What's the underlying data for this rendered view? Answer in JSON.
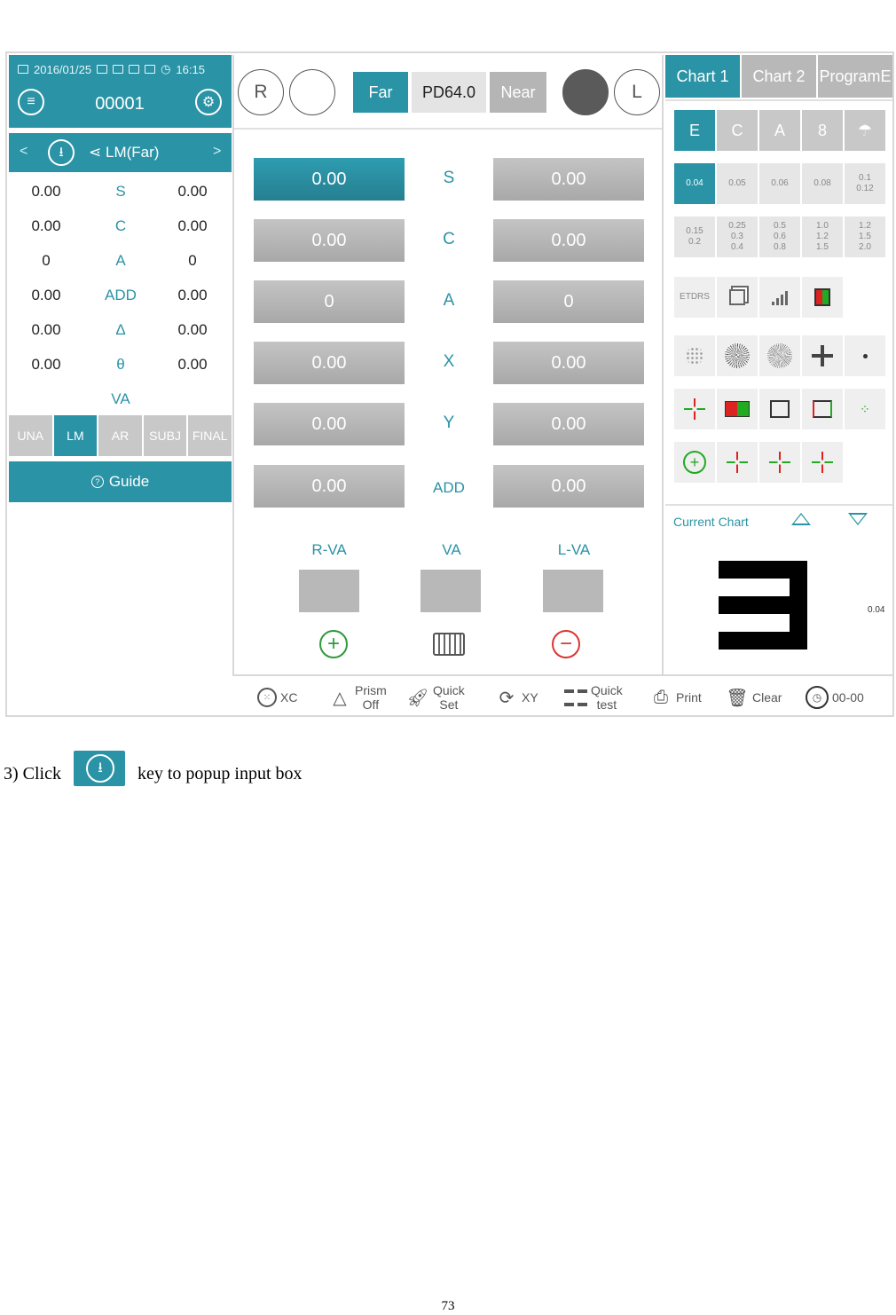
{
  "status": {
    "date": "2016/01/25",
    "time": "16:15"
  },
  "header": {
    "patient_id": "00001"
  },
  "subheader": {
    "prev": "<",
    "next": ">",
    "mode": "LM(Far)"
  },
  "measure_rows": [
    {
      "left": "0.00",
      "label": "S",
      "right": "0.00"
    },
    {
      "left": "0.00",
      "label": "C",
      "right": "0.00"
    },
    {
      "left": "0",
      "label": "A",
      "right": "0"
    },
    {
      "left": "0.00",
      "label": "ADD",
      "right": "0.00"
    },
    {
      "left": "0.00",
      "label": "Δ",
      "right": "0.00"
    },
    {
      "left": "0.00",
      "label": "θ",
      "right": "0.00"
    }
  ],
  "va_label": "VA",
  "stages": [
    "UNA",
    "LM",
    "AR",
    "SUBJ",
    "FINAL"
  ],
  "active_stage": "LM",
  "guide_label": "Guide",
  "top": {
    "right_eye": "R",
    "left_eye": "L",
    "far": "Far",
    "pd": "PD64.0",
    "near": "Near"
  },
  "params": [
    {
      "label": "S",
      "r": "0.00",
      "l": "0.00"
    },
    {
      "label": "C",
      "r": "0.00",
      "l": "0.00"
    },
    {
      "label": "A",
      "r": "0",
      "l": "0"
    },
    {
      "label": "X",
      "r": "0.00",
      "l": "0.00"
    },
    {
      "label": "Y",
      "r": "0.00",
      "l": "0.00"
    },
    {
      "label": "ADD",
      "r": "0.00",
      "l": "0.00"
    }
  ],
  "va_headers": {
    "r": "R-VA",
    "both": "VA",
    "l": "L-VA"
  },
  "chart_tabs": [
    "Chart 1",
    "Chart 2",
    "ProgramE"
  ],
  "optotypes": [
    "E",
    "C",
    "A",
    "8"
  ],
  "acuity_row1": [
    "0.04",
    "0.05",
    "0.06",
    "0.08",
    "0.1\n0.12"
  ],
  "acuity_row2": [
    "0.15\n0.2",
    "0.25\n0.3\n0.4",
    "0.5\n0.6\n0.8",
    "1.0\n1.2\n1.5",
    "1.2\n1.5\n2.0"
  ],
  "etdrs_label": "ETDRS",
  "current_chart": {
    "label": "Current Chart",
    "acuity": "0.04"
  },
  "toolbar": {
    "xc": "XC",
    "prism": "Prism\nOff",
    "quick_set": "Quick\nSet",
    "xy": "XY",
    "quick_test": "Quick\ntest",
    "print": "Print",
    "clear": "Clear",
    "timer": "00-00"
  },
  "caption": {
    "prefix": "3) Click",
    "suffix": "key to popup input box"
  },
  "page_number": "73",
  "colors": {
    "accent": "#2a93a6",
    "button_gray": "#b8b8b8",
    "plus_green": "#2e9a3a",
    "minus_red": "#dd3333"
  }
}
